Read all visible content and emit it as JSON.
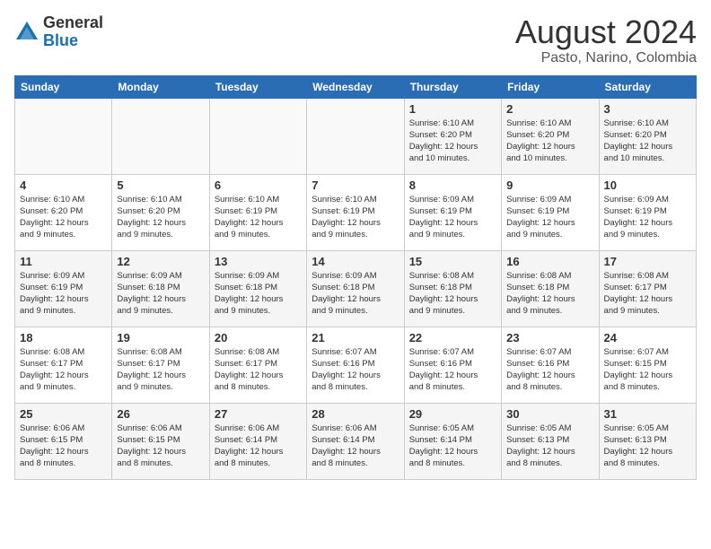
{
  "header": {
    "logo_general": "General",
    "logo_blue": "Blue",
    "title": "August 2024",
    "subtitle": "Pasto, Narino, Colombia"
  },
  "days_of_week": [
    "Sunday",
    "Monday",
    "Tuesday",
    "Wednesday",
    "Thursday",
    "Friday",
    "Saturday"
  ],
  "weeks": [
    [
      {
        "day": "",
        "info": ""
      },
      {
        "day": "",
        "info": ""
      },
      {
        "day": "",
        "info": ""
      },
      {
        "day": "",
        "info": ""
      },
      {
        "day": "1",
        "info": "Sunrise: 6:10 AM\nSunset: 6:20 PM\nDaylight: 12 hours\nand 10 minutes."
      },
      {
        "day": "2",
        "info": "Sunrise: 6:10 AM\nSunset: 6:20 PM\nDaylight: 12 hours\nand 10 minutes."
      },
      {
        "day": "3",
        "info": "Sunrise: 6:10 AM\nSunset: 6:20 PM\nDaylight: 12 hours\nand 10 minutes."
      }
    ],
    [
      {
        "day": "4",
        "info": "Sunrise: 6:10 AM\nSunset: 6:20 PM\nDaylight: 12 hours\nand 9 minutes."
      },
      {
        "day": "5",
        "info": "Sunrise: 6:10 AM\nSunset: 6:20 PM\nDaylight: 12 hours\nand 9 minutes."
      },
      {
        "day": "6",
        "info": "Sunrise: 6:10 AM\nSunset: 6:19 PM\nDaylight: 12 hours\nand 9 minutes."
      },
      {
        "day": "7",
        "info": "Sunrise: 6:10 AM\nSunset: 6:19 PM\nDaylight: 12 hours\nand 9 minutes."
      },
      {
        "day": "8",
        "info": "Sunrise: 6:09 AM\nSunset: 6:19 PM\nDaylight: 12 hours\nand 9 minutes."
      },
      {
        "day": "9",
        "info": "Sunrise: 6:09 AM\nSunset: 6:19 PM\nDaylight: 12 hours\nand 9 minutes."
      },
      {
        "day": "10",
        "info": "Sunrise: 6:09 AM\nSunset: 6:19 PM\nDaylight: 12 hours\nand 9 minutes."
      }
    ],
    [
      {
        "day": "11",
        "info": "Sunrise: 6:09 AM\nSunset: 6:19 PM\nDaylight: 12 hours\nand 9 minutes."
      },
      {
        "day": "12",
        "info": "Sunrise: 6:09 AM\nSunset: 6:18 PM\nDaylight: 12 hours\nand 9 minutes."
      },
      {
        "day": "13",
        "info": "Sunrise: 6:09 AM\nSunset: 6:18 PM\nDaylight: 12 hours\nand 9 minutes."
      },
      {
        "day": "14",
        "info": "Sunrise: 6:09 AM\nSunset: 6:18 PM\nDaylight: 12 hours\nand 9 minutes."
      },
      {
        "day": "15",
        "info": "Sunrise: 6:08 AM\nSunset: 6:18 PM\nDaylight: 12 hours\nand 9 minutes."
      },
      {
        "day": "16",
        "info": "Sunrise: 6:08 AM\nSunset: 6:18 PM\nDaylight: 12 hours\nand 9 minutes."
      },
      {
        "day": "17",
        "info": "Sunrise: 6:08 AM\nSunset: 6:17 PM\nDaylight: 12 hours\nand 9 minutes."
      }
    ],
    [
      {
        "day": "18",
        "info": "Sunrise: 6:08 AM\nSunset: 6:17 PM\nDaylight: 12 hours\nand 9 minutes."
      },
      {
        "day": "19",
        "info": "Sunrise: 6:08 AM\nSunset: 6:17 PM\nDaylight: 12 hours\nand 9 minutes."
      },
      {
        "day": "20",
        "info": "Sunrise: 6:08 AM\nSunset: 6:17 PM\nDaylight: 12 hours\nand 8 minutes."
      },
      {
        "day": "21",
        "info": "Sunrise: 6:07 AM\nSunset: 6:16 PM\nDaylight: 12 hours\nand 8 minutes."
      },
      {
        "day": "22",
        "info": "Sunrise: 6:07 AM\nSunset: 6:16 PM\nDaylight: 12 hours\nand 8 minutes."
      },
      {
        "day": "23",
        "info": "Sunrise: 6:07 AM\nSunset: 6:16 PM\nDaylight: 12 hours\nand 8 minutes."
      },
      {
        "day": "24",
        "info": "Sunrise: 6:07 AM\nSunset: 6:15 PM\nDaylight: 12 hours\nand 8 minutes."
      }
    ],
    [
      {
        "day": "25",
        "info": "Sunrise: 6:06 AM\nSunset: 6:15 PM\nDaylight: 12 hours\nand 8 minutes."
      },
      {
        "day": "26",
        "info": "Sunrise: 6:06 AM\nSunset: 6:15 PM\nDaylight: 12 hours\nand 8 minutes."
      },
      {
        "day": "27",
        "info": "Sunrise: 6:06 AM\nSunset: 6:14 PM\nDaylight: 12 hours\nand 8 minutes."
      },
      {
        "day": "28",
        "info": "Sunrise: 6:06 AM\nSunset: 6:14 PM\nDaylight: 12 hours\nand 8 minutes."
      },
      {
        "day": "29",
        "info": "Sunrise: 6:05 AM\nSunset: 6:14 PM\nDaylight: 12 hours\nand 8 minutes."
      },
      {
        "day": "30",
        "info": "Sunrise: 6:05 AM\nSunset: 6:13 PM\nDaylight: 12 hours\nand 8 minutes."
      },
      {
        "day": "31",
        "info": "Sunrise: 6:05 AM\nSunset: 6:13 PM\nDaylight: 12 hours\nand 8 minutes."
      }
    ]
  ]
}
